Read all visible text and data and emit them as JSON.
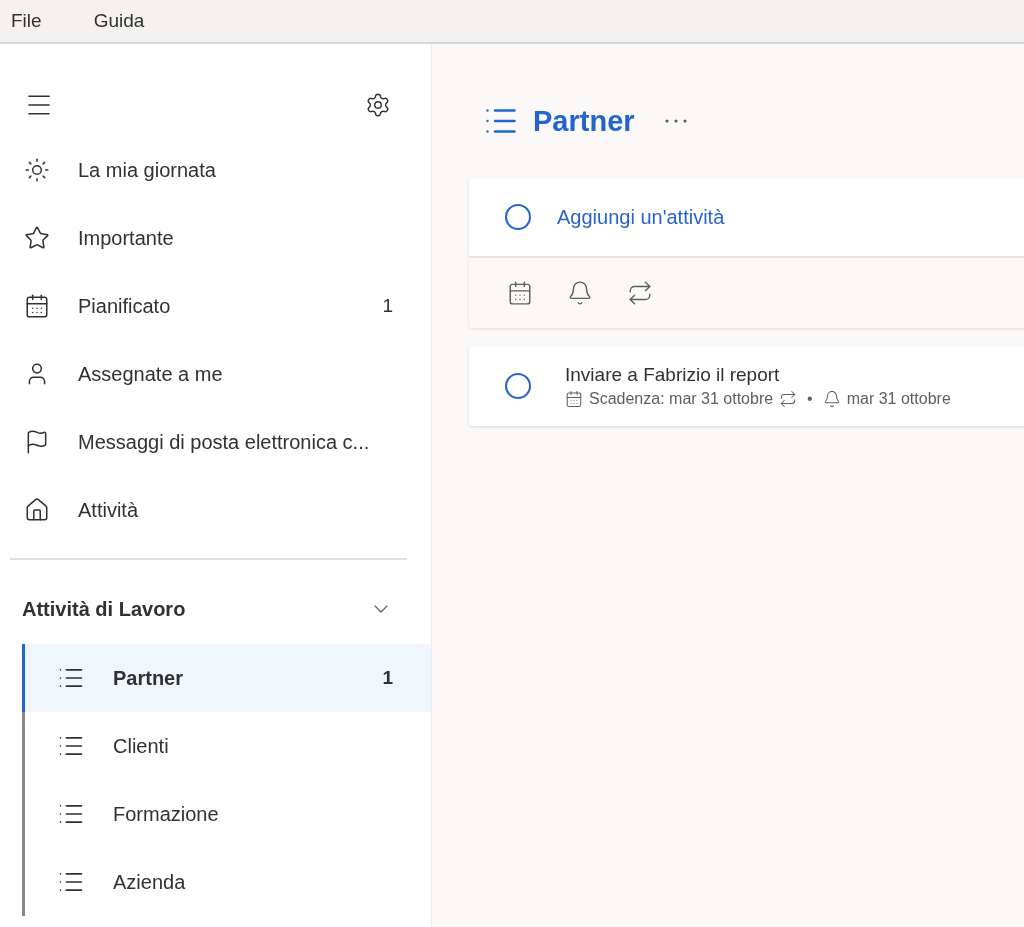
{
  "menu_bar": [
    {
      "label": "File"
    },
    {
      "label": "Guida"
    }
  ],
  "sidebar": {
    "smart_lists": [
      {
        "label": "La mia giornata",
        "selected": false
      },
      {
        "label": "Importante",
        "selected": false
      },
      {
        "label": "Pianificato",
        "count": "1",
        "selected": false
      },
      {
        "label": "Assegnate a me",
        "selected": false
      },
      {
        "label": "Messaggi di posta elettronica c...",
        "selected": false
      },
      {
        "label": "Attività",
        "selected": false
      }
    ],
    "groups": [
      {
        "title": "Attività di Lavoro",
        "expanded": true,
        "lists": [
          {
            "label": "Partner",
            "count": "1",
            "selected": true
          },
          {
            "label": "Clienti",
            "selected": false
          },
          {
            "label": "Formazione",
            "selected": false
          },
          {
            "label": "Azienda",
            "selected": false
          }
        ]
      }
    ]
  },
  "main": {
    "title": "Partner",
    "add_task": {
      "placeholder": "Aggiungi un'attività"
    },
    "tasks": [
      {
        "title": "Inviare a Fabrizio il report",
        "completed": false,
        "due": "Scadenza: mar 31 ottobre",
        "separator": "•",
        "reminder": "mar 31 ottobre"
      }
    ]
  }
}
